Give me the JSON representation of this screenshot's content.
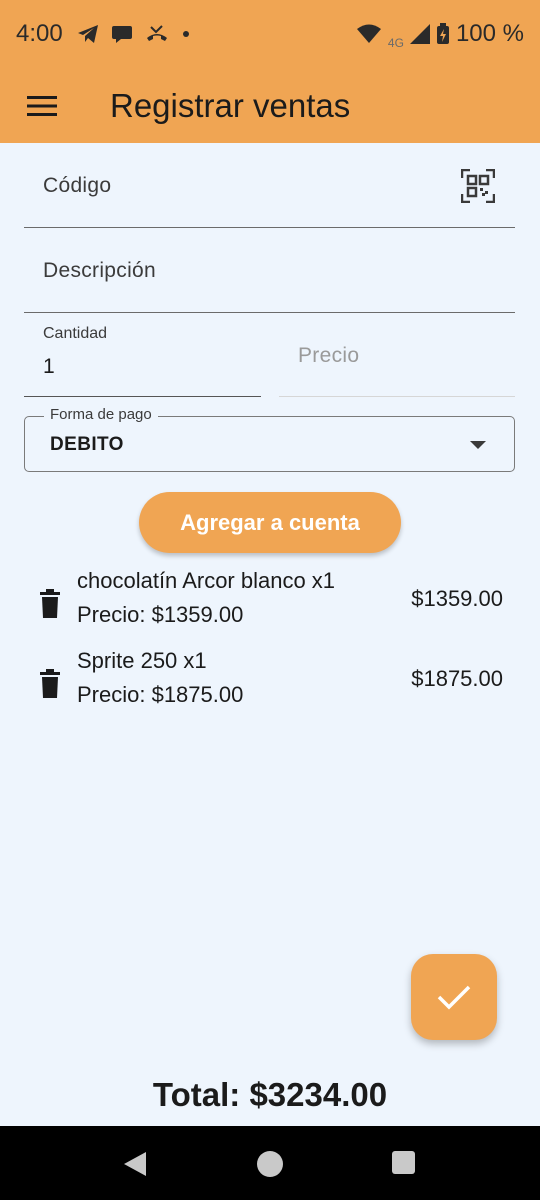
{
  "status_bar": {
    "time": "4:00",
    "network": "4G",
    "battery": "100 %"
  },
  "app_bar": {
    "title": "Registrar ventas",
    "menu_icon": "menu-icon",
    "background": "#f0a553"
  },
  "form": {
    "codigo_placeholder": "Código",
    "descripcion_placeholder": "Descripción",
    "cantidad_label": "Cantidad",
    "cantidad_value": "1",
    "precio_placeholder": "Precio",
    "payment_label": "Forma de pago",
    "payment_value": "DEBITO"
  },
  "add_button_label": "Agregar a cuenta",
  "items": [
    {
      "name": "chocolatín Arcor blanco x1",
      "price_line": "Precio: $1359.00",
      "amount": "$1359.00"
    },
    {
      "name": "Sprite 250 x1",
      "price_line": "Precio: $1875.00",
      "amount": "$1875.00"
    }
  ],
  "total": "Total: $3234.00",
  "accent_color": "#f0a553",
  "background_color": "#eef5fd"
}
